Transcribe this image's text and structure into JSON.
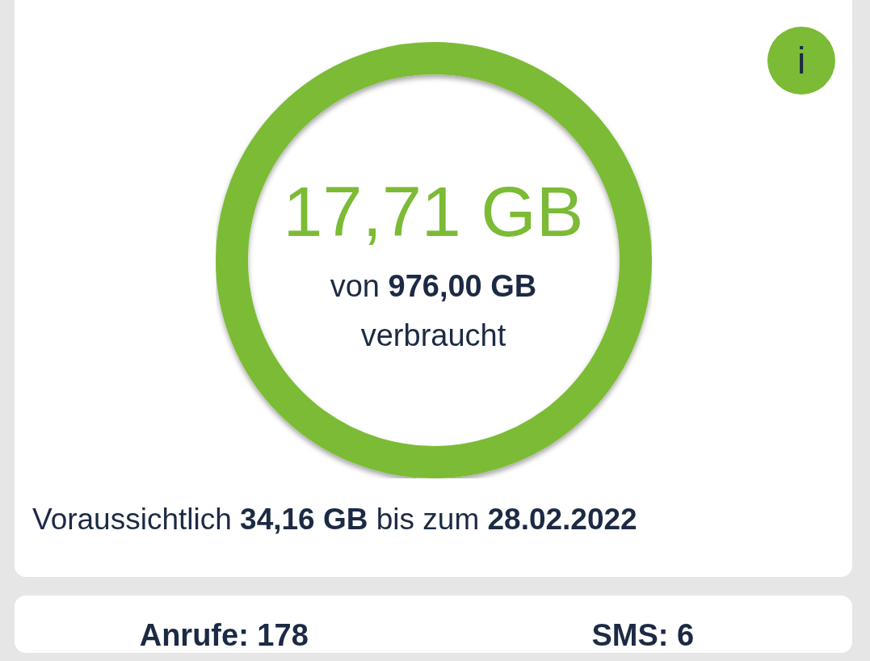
{
  "usage": {
    "used": "17,71 GB",
    "total_text": "von **976,00 GB**",
    "caption": "verbraucht",
    "info_button": "i"
  },
  "forecast": "Voraussichtlich **34,16 GB** bis zum **28.02.2022**",
  "stats": [
    {
      "label": "Anrufe: 178"
    },
    {
      "label": "SMS: 6"
    }
  ]
}
